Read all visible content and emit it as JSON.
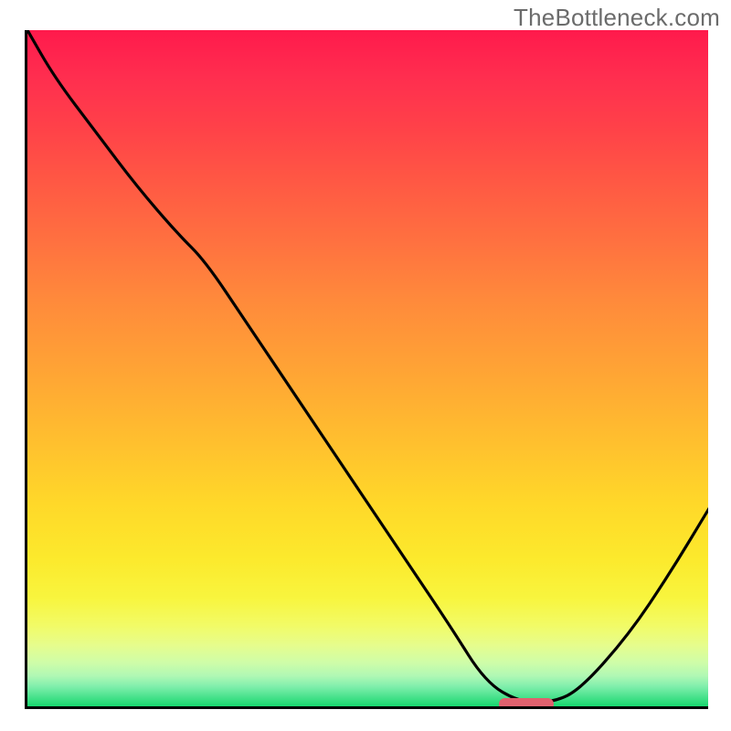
{
  "watermark": "TheBottleneck.com",
  "chart_data": {
    "type": "line",
    "title": "",
    "xlabel": "",
    "ylabel": "",
    "xlim": [
      0,
      100
    ],
    "ylim": [
      0,
      100
    ],
    "x": [
      0,
      4,
      10,
      16,
      22,
      26,
      32,
      40,
      48,
      56,
      62,
      67,
      72,
      77,
      81,
      88,
      94,
      100
    ],
    "values": [
      100,
      93,
      85,
      77,
      70,
      66,
      57,
      45,
      33,
      21,
      12,
      4,
      1,
      1,
      3,
      11,
      20,
      30
    ],
    "series": [
      {
        "name": "bottleneck-curve",
        "x": [
          0,
          4,
          10,
          16,
          22,
          26,
          32,
          40,
          48,
          56,
          62,
          67,
          72,
          77,
          81,
          88,
          94,
          100
        ],
        "values": [
          100,
          93,
          85,
          77,
          70,
          66,
          57,
          45,
          33,
          21,
          12,
          4,
          1,
          1,
          3,
          11,
          20,
          30
        ]
      }
    ],
    "optimum_marker": {
      "x_start": 69,
      "x_end": 77,
      "y": 0.8
    },
    "gradient_stops": [
      {
        "pos": 0,
        "color": "#ff1a4c"
      },
      {
        "pos": 50,
        "color": "#ffa335"
      },
      {
        "pos": 84,
        "color": "#f8f53e"
      },
      {
        "pos": 100,
        "color": "#18d86e"
      }
    ],
    "annotations": []
  }
}
